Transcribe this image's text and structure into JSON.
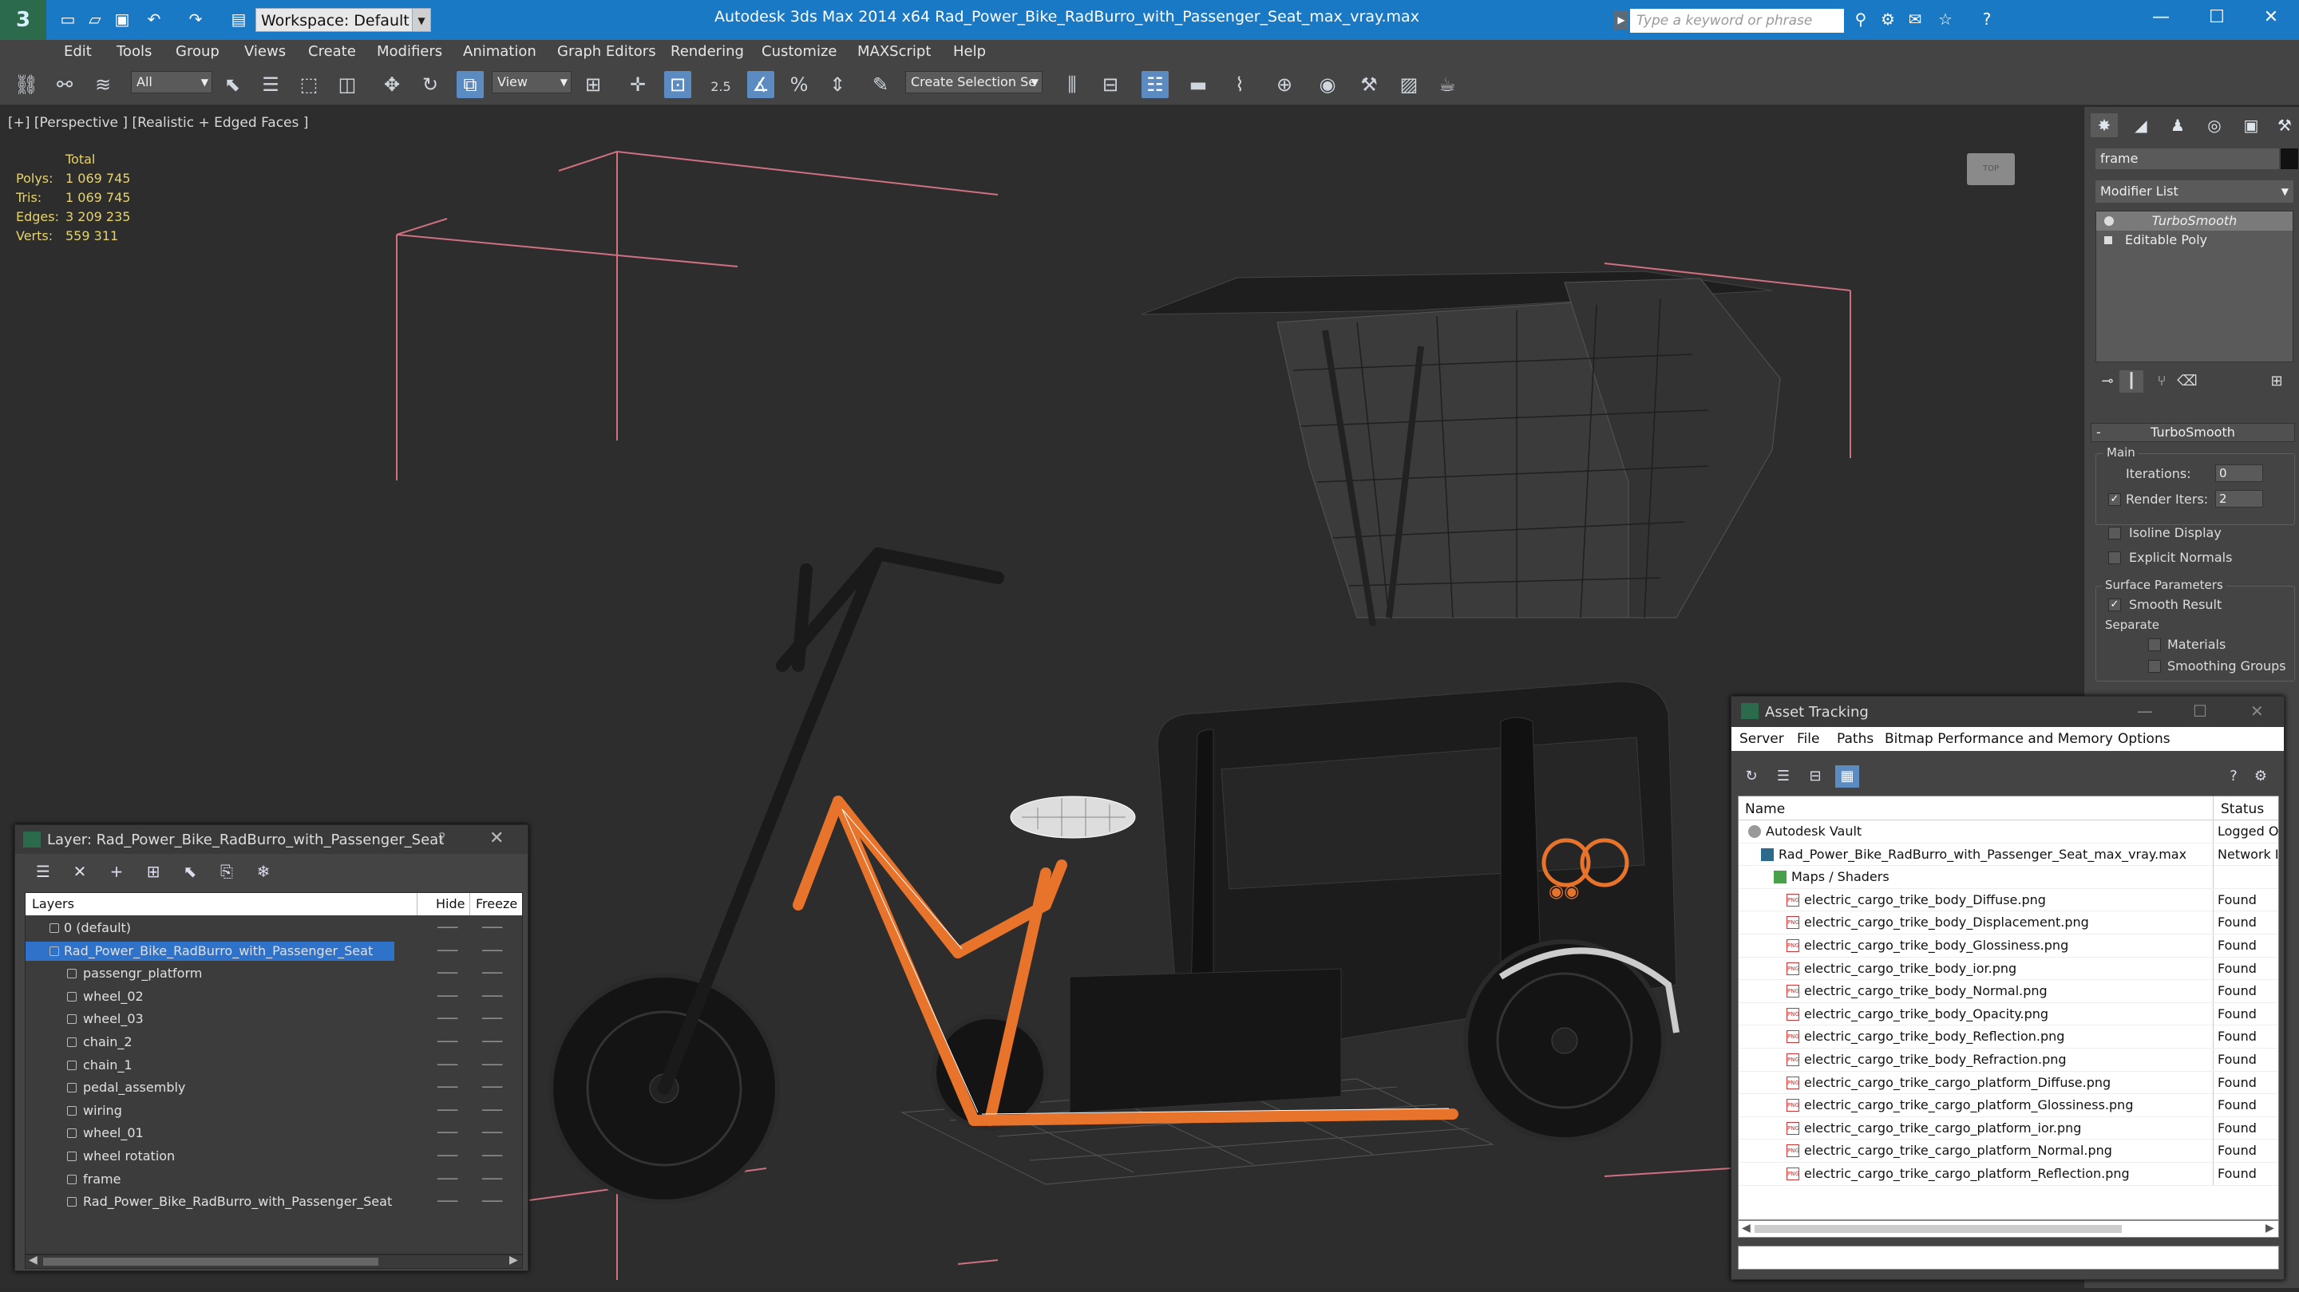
{
  "titlebar": {
    "workspace": "Workspace: Default",
    "title": "Autodesk 3ds Max  2014 x64        Rad_Power_Bike_RadBurro_with_Passenger_Seat_max_vray.max",
    "search_placeholder": "Type a keyword or phrase",
    "minimize": "—",
    "maximize": "☐",
    "close": "✕"
  },
  "menu": [
    "Edit",
    "Tools",
    "Group",
    "Views",
    "Create",
    "Modifiers",
    "Animation",
    "Graph Editors",
    "Rendering",
    "Customize",
    "MAXScript",
    "Help"
  ],
  "toolbar": {
    "selection_filter": "All",
    "ref_coord": "View",
    "snap_label": "2.5",
    "selection_set": "Create Selection Se"
  },
  "viewport": {
    "label": "[+] [Perspective ] [Realistic + Edged Faces ]",
    "stats": {
      "header": "Total",
      "rows": [
        {
          "label": "Polys:",
          "value": "1 069 745"
        },
        {
          "label": "Tris:",
          "value": "1 069 745"
        },
        {
          "label": "Edges:",
          "value": "3 209 235"
        },
        {
          "label": "Verts:",
          "value": "559 311"
        }
      ]
    },
    "viewcube_label": "TOP"
  },
  "command_panel": {
    "object_name": "frame",
    "modifier_list": "Modifier List",
    "stack": [
      {
        "label": "TurboSmooth",
        "selected": true
      },
      {
        "label": "Editable Poly",
        "selected": false
      }
    ],
    "rollout_title": "TurboSmooth",
    "main_group": "Main",
    "iterations_label": "Iterations:",
    "iterations_value": "0",
    "render_iters_label": "Render Iters:",
    "render_iters_value": "2",
    "isoline_label": "Isoline Display",
    "explicit_normals_label": "Explicit Normals",
    "surface_params_label": "Surface Parameters",
    "smooth_result_label": "Smooth Result",
    "separate_label": "Separate",
    "materials_label": "Materials",
    "smoothing_groups_label": "Smoothing Groups"
  },
  "layer_dialog": {
    "title": "Layer: Rad_Power_Bike_RadBurro_with_Passenger_Seat",
    "help": "?",
    "close": "✕",
    "columns": {
      "layers": "Layers",
      "hide": "Hide",
      "freeze": "Freeze"
    },
    "rows": [
      {
        "name": "0 (default)",
        "indent": 0,
        "type": "layer"
      },
      {
        "name": "Rad_Power_Bike_RadBurro_with_Passenger_Seat",
        "indent": 0,
        "type": "layer",
        "selected": true
      },
      {
        "name": "passengr_platform",
        "indent": 1,
        "type": "object"
      },
      {
        "name": "wheel_02",
        "indent": 1,
        "type": "object"
      },
      {
        "name": "wheel_03",
        "indent": 1,
        "type": "object"
      },
      {
        "name": "chain_2",
        "indent": 1,
        "type": "object"
      },
      {
        "name": "chain_1",
        "indent": 1,
        "type": "object"
      },
      {
        "name": "pedal_assembly",
        "indent": 1,
        "type": "object"
      },
      {
        "name": "wiring",
        "indent": 1,
        "type": "object"
      },
      {
        "name": "wheel_01",
        "indent": 1,
        "type": "object"
      },
      {
        "name": "wheel rotation",
        "indent": 1,
        "type": "object"
      },
      {
        "name": "frame",
        "indent": 1,
        "type": "object"
      },
      {
        "name": "Rad_Power_Bike_RadBurro_with_Passenger_Seat",
        "indent": 1,
        "type": "object"
      }
    ]
  },
  "asset_dialog": {
    "title": "Asset Tracking",
    "menu": [
      "Server",
      "File",
      "Paths",
      "Bitmap Performance and Memory",
      "Options"
    ],
    "columns": {
      "name": "Name",
      "status": "Status"
    },
    "rows": [
      {
        "name": "Autodesk Vault",
        "status": "Logged O",
        "icon": "vault",
        "indent": 0
      },
      {
        "name": "Rad_Power_Bike_RadBurro_with_Passenger_Seat_max_vray.max",
        "status": "Network I",
        "icon": "max",
        "indent": 1
      },
      {
        "name": "Maps / Shaders",
        "status": "",
        "icon": "maps",
        "indent": 2
      },
      {
        "name": "electric_cargo_trike_body_Diffuse.png",
        "status": "Found",
        "icon": "png",
        "indent": 3
      },
      {
        "name": "electric_cargo_trike_body_Displacement.png",
        "status": "Found",
        "icon": "png",
        "indent": 3
      },
      {
        "name": "electric_cargo_trike_body_Glossiness.png",
        "status": "Found",
        "icon": "png",
        "indent": 3
      },
      {
        "name": "electric_cargo_trike_body_ior.png",
        "status": "Found",
        "icon": "png",
        "indent": 3
      },
      {
        "name": "electric_cargo_trike_body_Normal.png",
        "status": "Found",
        "icon": "png",
        "indent": 3
      },
      {
        "name": "electric_cargo_trike_body_Opacity.png",
        "status": "Found",
        "icon": "png",
        "indent": 3
      },
      {
        "name": "electric_cargo_trike_body_Reflection.png",
        "status": "Found",
        "icon": "png",
        "indent": 3
      },
      {
        "name": "electric_cargo_trike_body_Refraction.png",
        "status": "Found",
        "icon": "png",
        "indent": 3
      },
      {
        "name": "electric_cargo_trike_cargo_platform_Diffuse.png",
        "status": "Found",
        "icon": "png",
        "indent": 3
      },
      {
        "name": "electric_cargo_trike_cargo_platform_Glossiness.png",
        "status": "Found",
        "icon": "png",
        "indent": 3
      },
      {
        "name": "electric_cargo_trike_cargo_platform_ior.png",
        "status": "Found",
        "icon": "png",
        "indent": 3
      },
      {
        "name": "electric_cargo_trike_cargo_platform_Normal.png",
        "status": "Found",
        "icon": "png",
        "indent": 3
      },
      {
        "name": "electric_cargo_trike_cargo_platform_Reflection.png",
        "status": "Found",
        "icon": "png",
        "indent": 3
      }
    ]
  },
  "colors": {
    "titlebar": "#1a79c4",
    "selection": "#2f72c9",
    "stats_text": "#e6d36a",
    "frame_orange": "#e8732a",
    "bbox_pink": "#d07080"
  }
}
